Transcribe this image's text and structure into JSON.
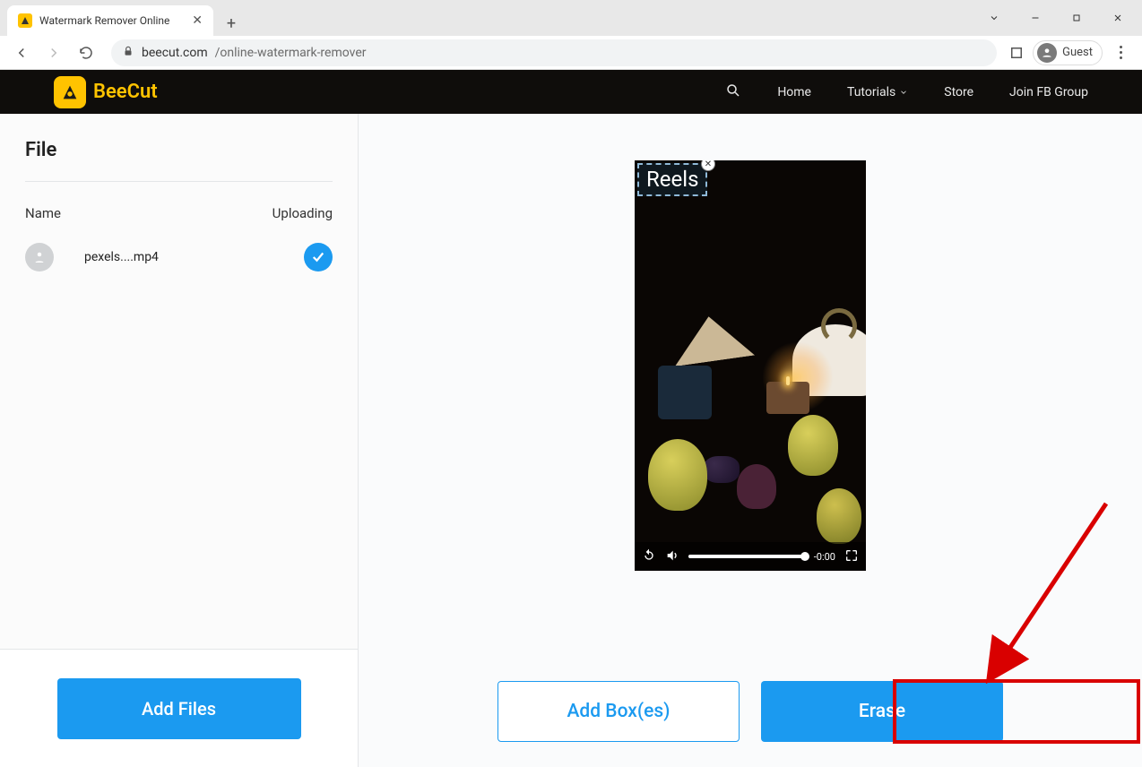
{
  "browser": {
    "tab_title": "Watermark Remover Online",
    "url_domain": "beecut.com",
    "url_path": "/online-watermark-remover",
    "guest_label": "Guest"
  },
  "site": {
    "brand": "BeeCut",
    "nav": {
      "home": "Home",
      "tutorials": "Tutorials",
      "store": "Store",
      "fbgroup": "Join FB Group"
    }
  },
  "sidebar": {
    "heading": "File",
    "col_name": "Name",
    "col_status": "Uploading",
    "files": [
      {
        "name": "pexels....mp4",
        "uploaded": true
      }
    ],
    "add_files_label": "Add Files"
  },
  "preview": {
    "watermark_text": "Reels",
    "time_label": "-0:00"
  },
  "actions": {
    "add_boxes": "Add Box(es)",
    "erase": "Erase"
  }
}
